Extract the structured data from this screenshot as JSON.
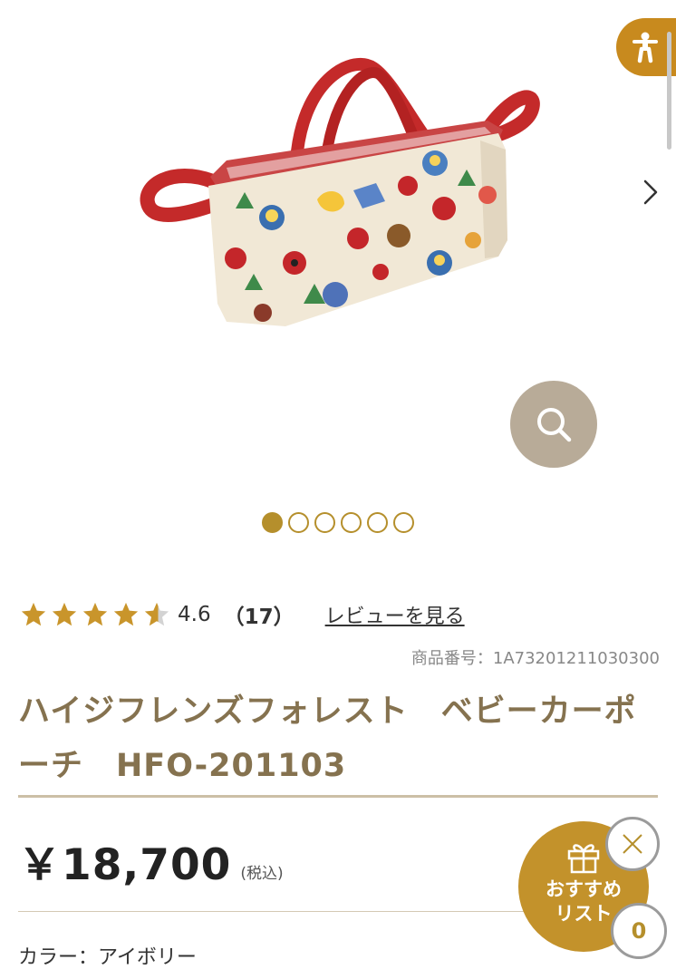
{
  "gallery": {
    "image_alt": "ハイジフレンズフォレスト ベビーカーポーチ",
    "slide_count": 6,
    "active_slide": 1,
    "icons": {
      "next": "chevron-right-icon",
      "zoom": "magnifier-icon"
    }
  },
  "accessibility": {
    "icon": "accessibility-person-icon"
  },
  "rating": {
    "stars": 4.6,
    "value": "4.6",
    "count": "（17）",
    "review_link": "レビューを見る"
  },
  "product": {
    "sku_label": "商品番号：",
    "sku": "1A73201211030300",
    "title": "ハイジフレンズフォレスト　ベビーカーポーチ　HFO-201103",
    "price": "￥18,700",
    "tax": "(税込)",
    "color": "カラー：アイボリー"
  },
  "recommend": {
    "label_line1": "おすすめ",
    "label_line2": "リスト",
    "count": "0",
    "icon": "gift-icon",
    "close_icon": "close-icon"
  },
  "colors": {
    "accent_gold": "#b58f2c",
    "title_brown": "#85724f",
    "recommend_bg": "#c3922b",
    "zoom_bg": "#b8ab98"
  }
}
